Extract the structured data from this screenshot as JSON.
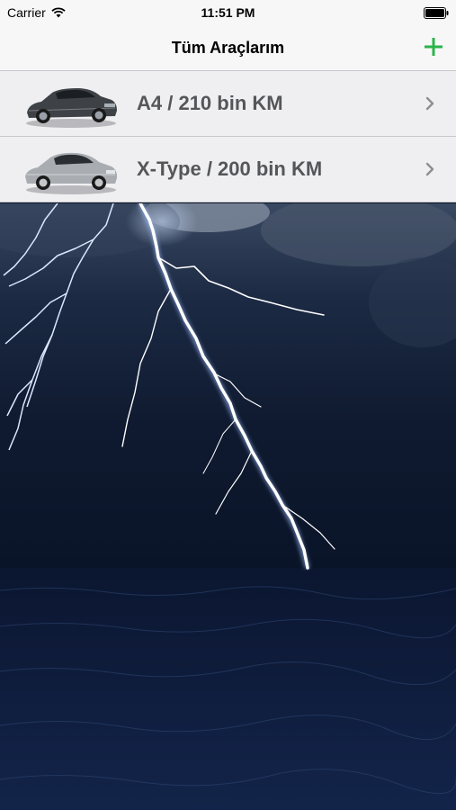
{
  "status_bar": {
    "carrier": "Carrier",
    "time": "11:51 PM",
    "wifi_icon": "wifi-icon",
    "battery_icon": "battery-icon"
  },
  "nav": {
    "title": "Tüm Araçlarım",
    "add_icon": "plus-icon",
    "accent_color": "#2bb34a"
  },
  "vehicles": [
    {
      "label": "A4 / 210 bin KM",
      "image": "car-thumbnail-sedan-dark",
      "chevron_icon": "chevron-right-icon"
    },
    {
      "label": "X-Type / 200 bin KM",
      "image": "car-thumbnail-sedan-silver",
      "chevron_icon": "chevron-right-icon"
    }
  ],
  "background": "lightning-over-sea-photo"
}
